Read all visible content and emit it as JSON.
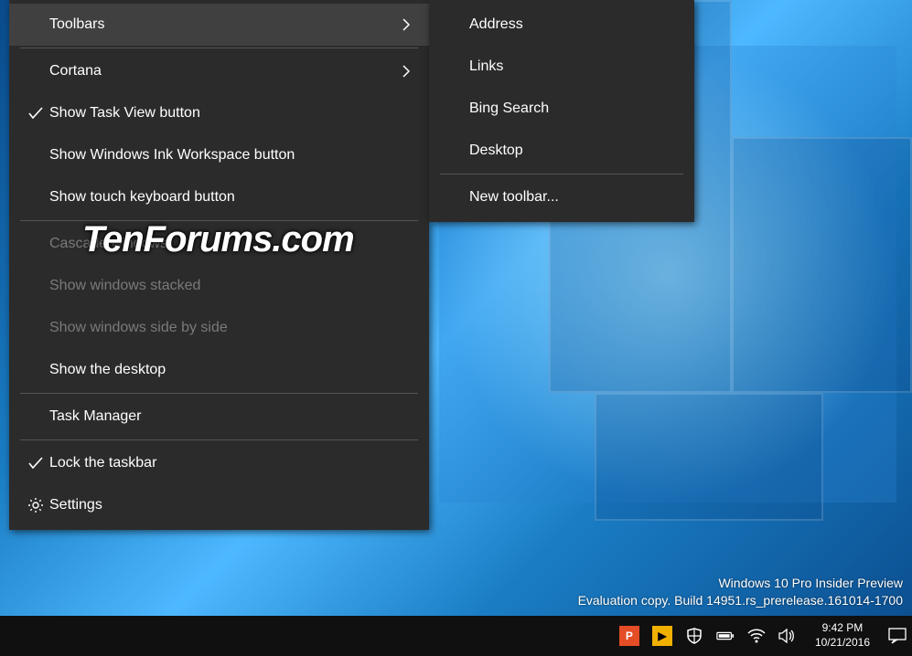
{
  "context_menu": {
    "items": [
      {
        "label": "Toolbars",
        "submenu": true,
        "highlight": true
      },
      {
        "separator": true
      },
      {
        "label": "Cortana",
        "submenu": true
      },
      {
        "label": "Show Task View button",
        "checked": true
      },
      {
        "label": "Show Windows Ink Workspace button"
      },
      {
        "label": "Show touch keyboard button"
      },
      {
        "separator": true
      },
      {
        "label": "Cascade windows",
        "disabled": true
      },
      {
        "label": "Show windows stacked",
        "disabled": true
      },
      {
        "label": "Show windows side by side",
        "disabled": true
      },
      {
        "label": "Show the desktop"
      },
      {
        "separator": true
      },
      {
        "label": "Task Manager"
      },
      {
        "separator": true
      },
      {
        "label": "Lock the taskbar",
        "checked": true
      },
      {
        "label": "Settings",
        "icon": "gear"
      }
    ]
  },
  "submenu": {
    "items": [
      {
        "label": "Address"
      },
      {
        "label": "Links"
      },
      {
        "label": "Bing Search"
      },
      {
        "label": "Desktop"
      },
      {
        "separator": true
      },
      {
        "label": "New toolbar..."
      }
    ]
  },
  "desktop_watermark": {
    "line1": "Windows 10 Pro Insider Preview",
    "line2": "Evaluation copy. Build 14951.rs_prerelease.161014-1700"
  },
  "taskbar": {
    "clock_time": "9:42 PM",
    "clock_date": "10/21/2016"
  },
  "branding": "TenForums.com"
}
